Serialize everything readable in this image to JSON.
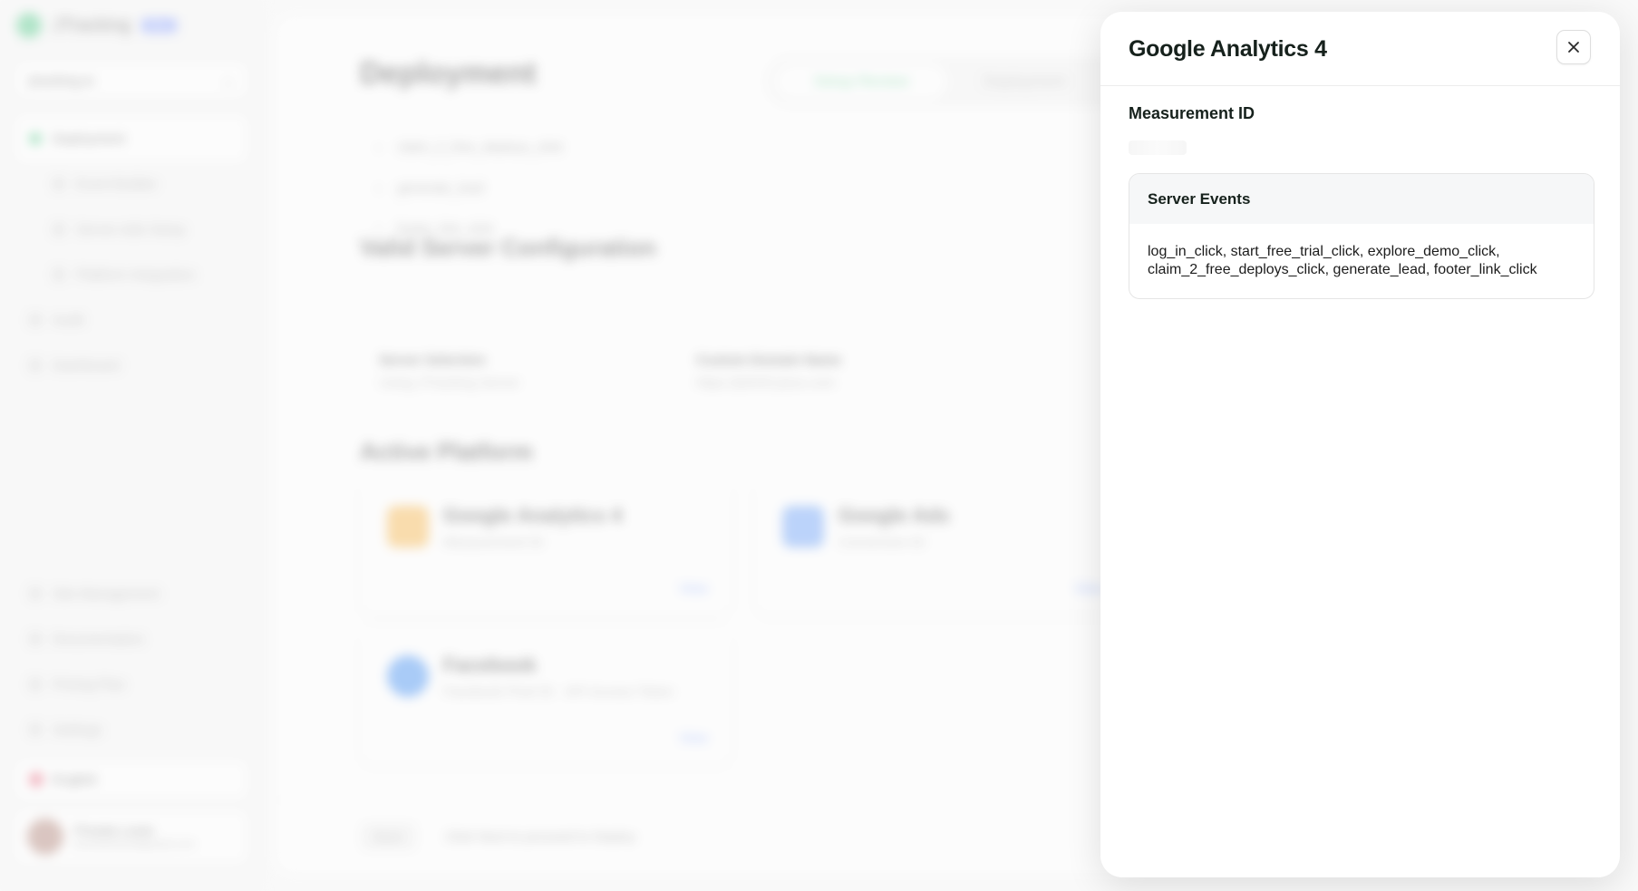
{
  "background_app": {
    "brand": {
      "name": "JTracking",
      "badge": "Beta"
    },
    "workspace": "jtracking.io",
    "nav": [
      {
        "label": "Deployment",
        "active": true
      },
      {
        "label": "Event Builder",
        "sub": true
      },
      {
        "label": "Server-side Setup",
        "sub": true
      },
      {
        "label": "Platform Integration",
        "sub": true
      },
      {
        "label": "Audit"
      },
      {
        "label": "Dashboard"
      }
    ],
    "nav_bottom": [
      {
        "label": "Site Management"
      },
      {
        "label": "Documentation"
      },
      {
        "label": "Pricing Plan"
      },
      {
        "label": "Settings"
      }
    ],
    "language": "English",
    "user": {
      "name": "Phoebe Lewis",
      "email": "phoebelewis@gmail.com"
    },
    "page_title": "Deployment",
    "tabs": [
      "Setup Review",
      "Deployment"
    ],
    "events": [
      "claim_2_free_deploys_click",
      "generate_lead",
      "footer_link_click"
    ],
    "config_title": "Valid Server Configuration",
    "config": {
      "server_label": "Server Selection",
      "server_value": "Using JTracking Server",
      "domain_label": "Custom Domain Name",
      "domain_value": "https://jt4545.jtsso.com"
    },
    "platforms_title": "Active Platform",
    "platforms": [
      {
        "name": "Google Analytics 4",
        "sub": "Measurement ID",
        "action": "View"
      },
      {
        "name": "Google Ads",
        "sub": "Conversion ID",
        "action": "View"
      },
      {
        "name": "Facebook",
        "sub": "Facebook Pixel ID · API Access Token",
        "action": "View"
      }
    ],
    "footer": {
      "button": "Back",
      "text": "Click Next to proceed to Deploy"
    }
  },
  "drawer": {
    "title": "Google Analytics 4",
    "close_icon": "close-icon",
    "measurement_id_label": "Measurement ID",
    "measurement_id_value": "",
    "server_events_title": "Server Events",
    "server_events_line1": "log_in_click, start_free_trial_click, explore_demo_click,",
    "server_events_line2": "claim_2_free_deploys_click, generate_lead, footer_link_click"
  }
}
